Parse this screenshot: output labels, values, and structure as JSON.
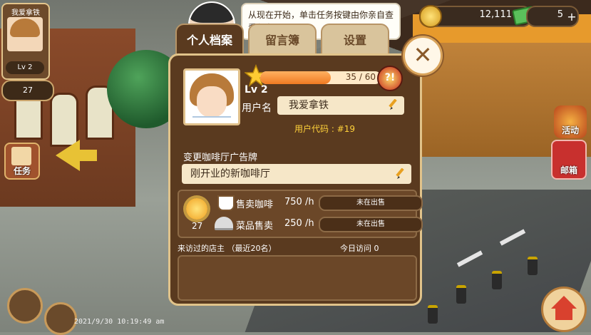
{
  "profile_mini": {
    "name": "我爱拿铁",
    "level": "Lv 2",
    "coins": "27"
  },
  "currency": {
    "coins": "12,111",
    "cash": "5"
  },
  "side_buttons": {
    "task": "任务",
    "activity": "活动",
    "mailbox": "邮箱"
  },
  "tutorial": {
    "message": "从现在开始，单击任务按键由你亲自查看任务吧。"
  },
  "tabs": [
    {
      "label": "个人档案"
    },
    {
      "label": "留言簿"
    },
    {
      "label": "设置"
    }
  ],
  "profile": {
    "level": "Lv 2",
    "exp_text": "35 / 60",
    "exp_progress": 0.583,
    "username_label": "用户名",
    "username": "我爱拿铁",
    "user_code": "用户代码 : #19",
    "sign_label": "变更咖啡厅广告牌",
    "sign_text": "刚开业的新咖啡厅",
    "popularity": "27"
  },
  "sales": [
    {
      "label": "售卖咖啡",
      "rate": "750 /h",
      "status": "未在出售"
    },
    {
      "label": "菜品售卖",
      "rate": "250 /h",
      "status": "未在出售"
    }
  ],
  "visitors": {
    "label": "来访过的店主 （最近20名）",
    "today": "今日访问 0"
  },
  "timestamp": "2021/9/30 10:19:49 am",
  "colors": {
    "panel": "#5a3a1f",
    "accent_gold": "#ffd23a",
    "exp_fill": "#f07a22"
  }
}
